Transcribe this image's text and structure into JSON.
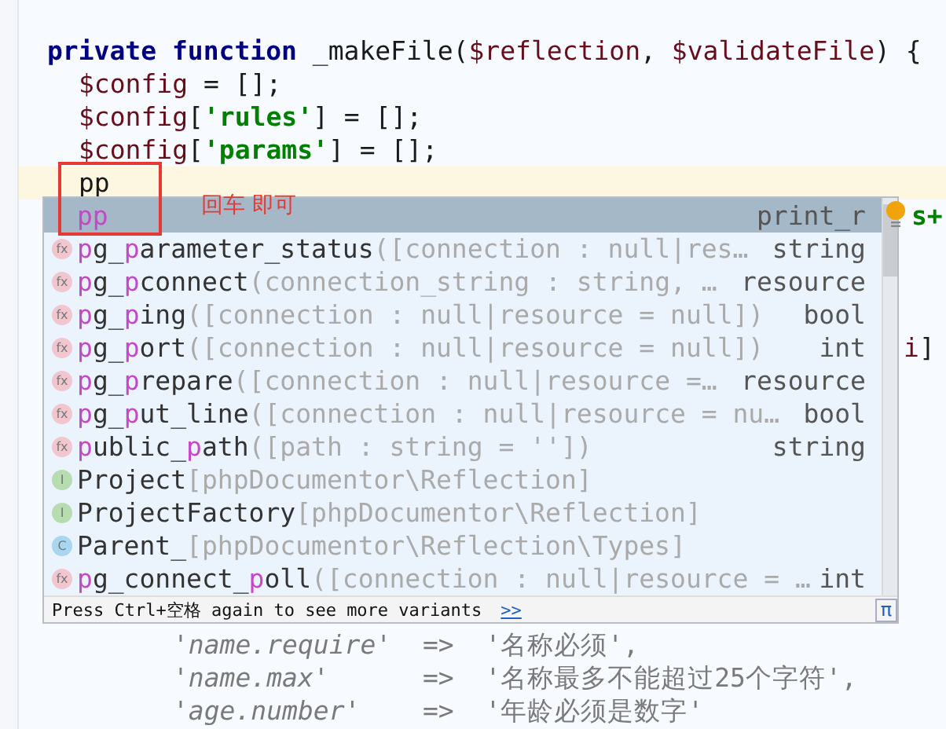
{
  "editor": {
    "top_lines": [
      {
        "current": false,
        "segments": [
          {
            "text": "private function",
            "kind": "keyword"
          },
          {
            "text": " _makeFile(",
            "kind": "plain"
          },
          {
            "text": "$reflection",
            "kind": "variable"
          },
          {
            "text": ", ",
            "kind": "plain"
          },
          {
            "text": "$validateFile",
            "kind": "variable"
          },
          {
            "text": ") {",
            "kind": "plain"
          }
        ]
      },
      {
        "current": false,
        "segments": [
          {
            "text": "$config",
            "kind": "variable"
          },
          {
            "text": " = [];",
            "kind": "plain"
          }
        ]
      },
      {
        "current": false,
        "segments": [
          {
            "text": "$config",
            "kind": "variable"
          },
          {
            "text": "[",
            "kind": "plain"
          },
          {
            "text": "'rules'",
            "kind": "string"
          },
          {
            "text": "] = [];",
            "kind": "plain"
          }
        ]
      },
      {
        "current": false,
        "segments": [
          {
            "text": "$config",
            "kind": "variable"
          },
          {
            "text": "[",
            "kind": "plain"
          },
          {
            "text": "'params'",
            "kind": "string"
          },
          {
            "text": "] = [];",
            "kind": "plain"
          }
        ]
      },
      {
        "current": true,
        "segments": [
          {
            "text": "pp",
            "kind": "plain"
          }
        ]
      }
    ],
    "covered_fragments": [
      {
        "segments": [
          {
            "text": "s+",
            "kind": "string"
          }
        ]
      },
      {
        "segments": [
          {
            "text": "i",
            "kind": "variable"
          },
          {
            "text": "]",
            "kind": "plain"
          }
        ]
      }
    ],
    "bottom_lines": [
      {
        "current": false,
        "segments": [
          {
            "text": "'name.require'",
            "kind": "key"
          },
          {
            "text": "  =>  ",
            "kind": "faded"
          },
          {
            "text": "'名称必须',",
            "kind": "faded"
          }
        ]
      },
      {
        "current": false,
        "segments": [
          {
            "text": "'name.max'",
            "kind": "key"
          },
          {
            "text": "      =>  ",
            "kind": "faded"
          },
          {
            "text": "'名称最多不能超过25个字符',",
            "kind": "faded"
          }
        ]
      },
      {
        "current": false,
        "segments": [
          {
            "text": "'age.number'",
            "kind": "key"
          },
          {
            "text": "    =>  ",
            "kind": "faded"
          },
          {
            "text": "'年龄必须是数字'",
            "kind": "faded"
          }
        ]
      }
    ]
  },
  "annotation": {
    "note": "回车 即可"
  },
  "completion": {
    "items": [
      {
        "kind": "template",
        "selected": true,
        "name": [
          {
            "text": "pp",
            "match": true
          }
        ],
        "type": "print_r"
      },
      {
        "kind": "function",
        "icon": "fx",
        "selected": false,
        "name": [
          {
            "text": "p",
            "match": true
          },
          {
            "text": "g_",
            "match": false
          },
          {
            "text": "p",
            "match": true
          },
          {
            "text": "arameter_status",
            "match": false
          }
        ],
        "signature": "([connection : null|res…",
        "type": "string"
      },
      {
        "kind": "function",
        "icon": "fx",
        "selected": false,
        "name": [
          {
            "text": "p",
            "match": true
          },
          {
            "text": "g_",
            "match": false
          },
          {
            "text": "p",
            "match": true
          },
          {
            "text": "connect",
            "match": false
          }
        ],
        "signature": "(connection_string : string, …",
        "type": "resource"
      },
      {
        "kind": "function",
        "icon": "fx",
        "selected": false,
        "name": [
          {
            "text": "p",
            "match": true
          },
          {
            "text": "g_",
            "match": false
          },
          {
            "text": "p",
            "match": true
          },
          {
            "text": "ing",
            "match": false
          }
        ],
        "signature": "([connection : null|resource = null])",
        "type": "bool"
      },
      {
        "kind": "function",
        "icon": "fx",
        "selected": false,
        "name": [
          {
            "text": "p",
            "match": true
          },
          {
            "text": "g_",
            "match": false
          },
          {
            "text": "p",
            "match": true
          },
          {
            "text": "ort",
            "match": false
          }
        ],
        "signature": "([connection : null|resource = null])",
        "type": "int"
      },
      {
        "kind": "function",
        "icon": "fx",
        "selected": false,
        "name": [
          {
            "text": "p",
            "match": true
          },
          {
            "text": "g_",
            "match": false
          },
          {
            "text": "p",
            "match": true
          },
          {
            "text": "repare",
            "match": false
          }
        ],
        "signature": "([connection : null|resource =…",
        "type": "resource"
      },
      {
        "kind": "function",
        "icon": "fx",
        "selected": false,
        "name": [
          {
            "text": "p",
            "match": true
          },
          {
            "text": "g_",
            "match": false
          },
          {
            "text": "p",
            "match": true
          },
          {
            "text": "ut_line",
            "match": false
          }
        ],
        "signature": "([connection : null|resource = nu…",
        "type": "bool"
      },
      {
        "kind": "function",
        "icon": "fx",
        "selected": false,
        "name": [
          {
            "text": "p",
            "match": true
          },
          {
            "text": "ublic_",
            "match": false
          },
          {
            "text": "p",
            "match": true
          },
          {
            "text": "ath",
            "match": false
          }
        ],
        "signature": "([path : string = ''])",
        "type": "string"
      },
      {
        "kind": "interface",
        "icon": "I",
        "selected": false,
        "name": [
          {
            "text": "Project",
            "match": false
          }
        ],
        "signature": "[phpDocumentor\\Reflection]"
      },
      {
        "kind": "interface",
        "icon": "I",
        "selected": false,
        "name": [
          {
            "text": "ProjectFactory",
            "match": false
          }
        ],
        "signature": "[phpDocumentor\\Reflection]"
      },
      {
        "kind": "class",
        "icon": "C",
        "selected": false,
        "name": [
          {
            "text": "Parent_",
            "match": false
          }
        ],
        "signature": "[phpDocumentor\\Reflection\\Types]"
      },
      {
        "kind": "function",
        "icon": "fx",
        "selected": false,
        "name": [
          {
            "text": "p",
            "match": true
          },
          {
            "text": "g_connect_",
            "match": false
          },
          {
            "text": "p",
            "match": true
          },
          {
            "text": "oll",
            "match": false
          }
        ],
        "signature": "([connection : null|resource = …",
        "type": "int"
      }
    ],
    "footer": {
      "hint": "Press Ctrl+空格 again to see more variants",
      "more_link": ">>",
      "pi": "π"
    }
  }
}
